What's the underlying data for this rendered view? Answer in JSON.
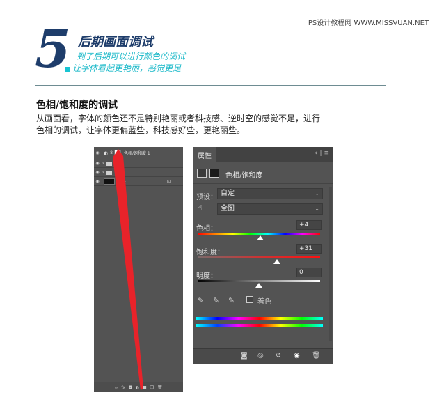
{
  "watermark": "PS设计教程网 WWW.MISSVUAN.NET",
  "step": {
    "number": "5",
    "title": "后期画面调试",
    "subtitle_line1": "到了后期可以进行颜色的调试",
    "subtitle_line2": "让字体看起更艳丽，感觉更足"
  },
  "section": {
    "heading": "色相/饱和度的调试",
    "body_line1": "从画面看，字体的颜色还不是特别艳丽或者科技感、逆时空的感觉不足，进行",
    "body_line2": "色相的调试，让字体更偏蓝些，科技感好些，更艳丽些。"
  },
  "layers_panel": {
    "layers": [
      {
        "name": "色相/饱和度 1",
        "type": "adjustment"
      },
      {
        "name": "光效",
        "type": "group"
      },
      {
        "name": "主体",
        "type": "group"
      },
      {
        "name": "背景",
        "type": "background"
      }
    ],
    "footer_icons": [
      "link-icon",
      "fx-icon",
      "mask-icon",
      "adjustment-icon",
      "folder-icon",
      "new-layer-icon",
      "trash-icon"
    ],
    "footer_glyphs": [
      "∞",
      "fx",
      "◘",
      "◐",
      "■",
      "❐",
      "🗑"
    ]
  },
  "properties_panel": {
    "tab_label": "属性",
    "header_controls": "» | ≡",
    "adjustment_title": "色相/饱和度",
    "preset_label": "预设：",
    "preset_value": "自定",
    "channel_value": "全图",
    "hue": {
      "label": "色相：",
      "value": "+4",
      "level": 0.51
    },
    "saturation": {
      "label": "饱和度：",
      "value": "+31",
      "level": 0.65
    },
    "lightness": {
      "label": "明度：",
      "value": "0",
      "level": 0.5
    },
    "colorize_label": "着色",
    "colors": {
      "panel_bg": "#535353",
      "accent_navy": "#1e3d6b",
      "accent_cyan": "#18b8c8",
      "arrow_red": "#e8232a"
    }
  }
}
